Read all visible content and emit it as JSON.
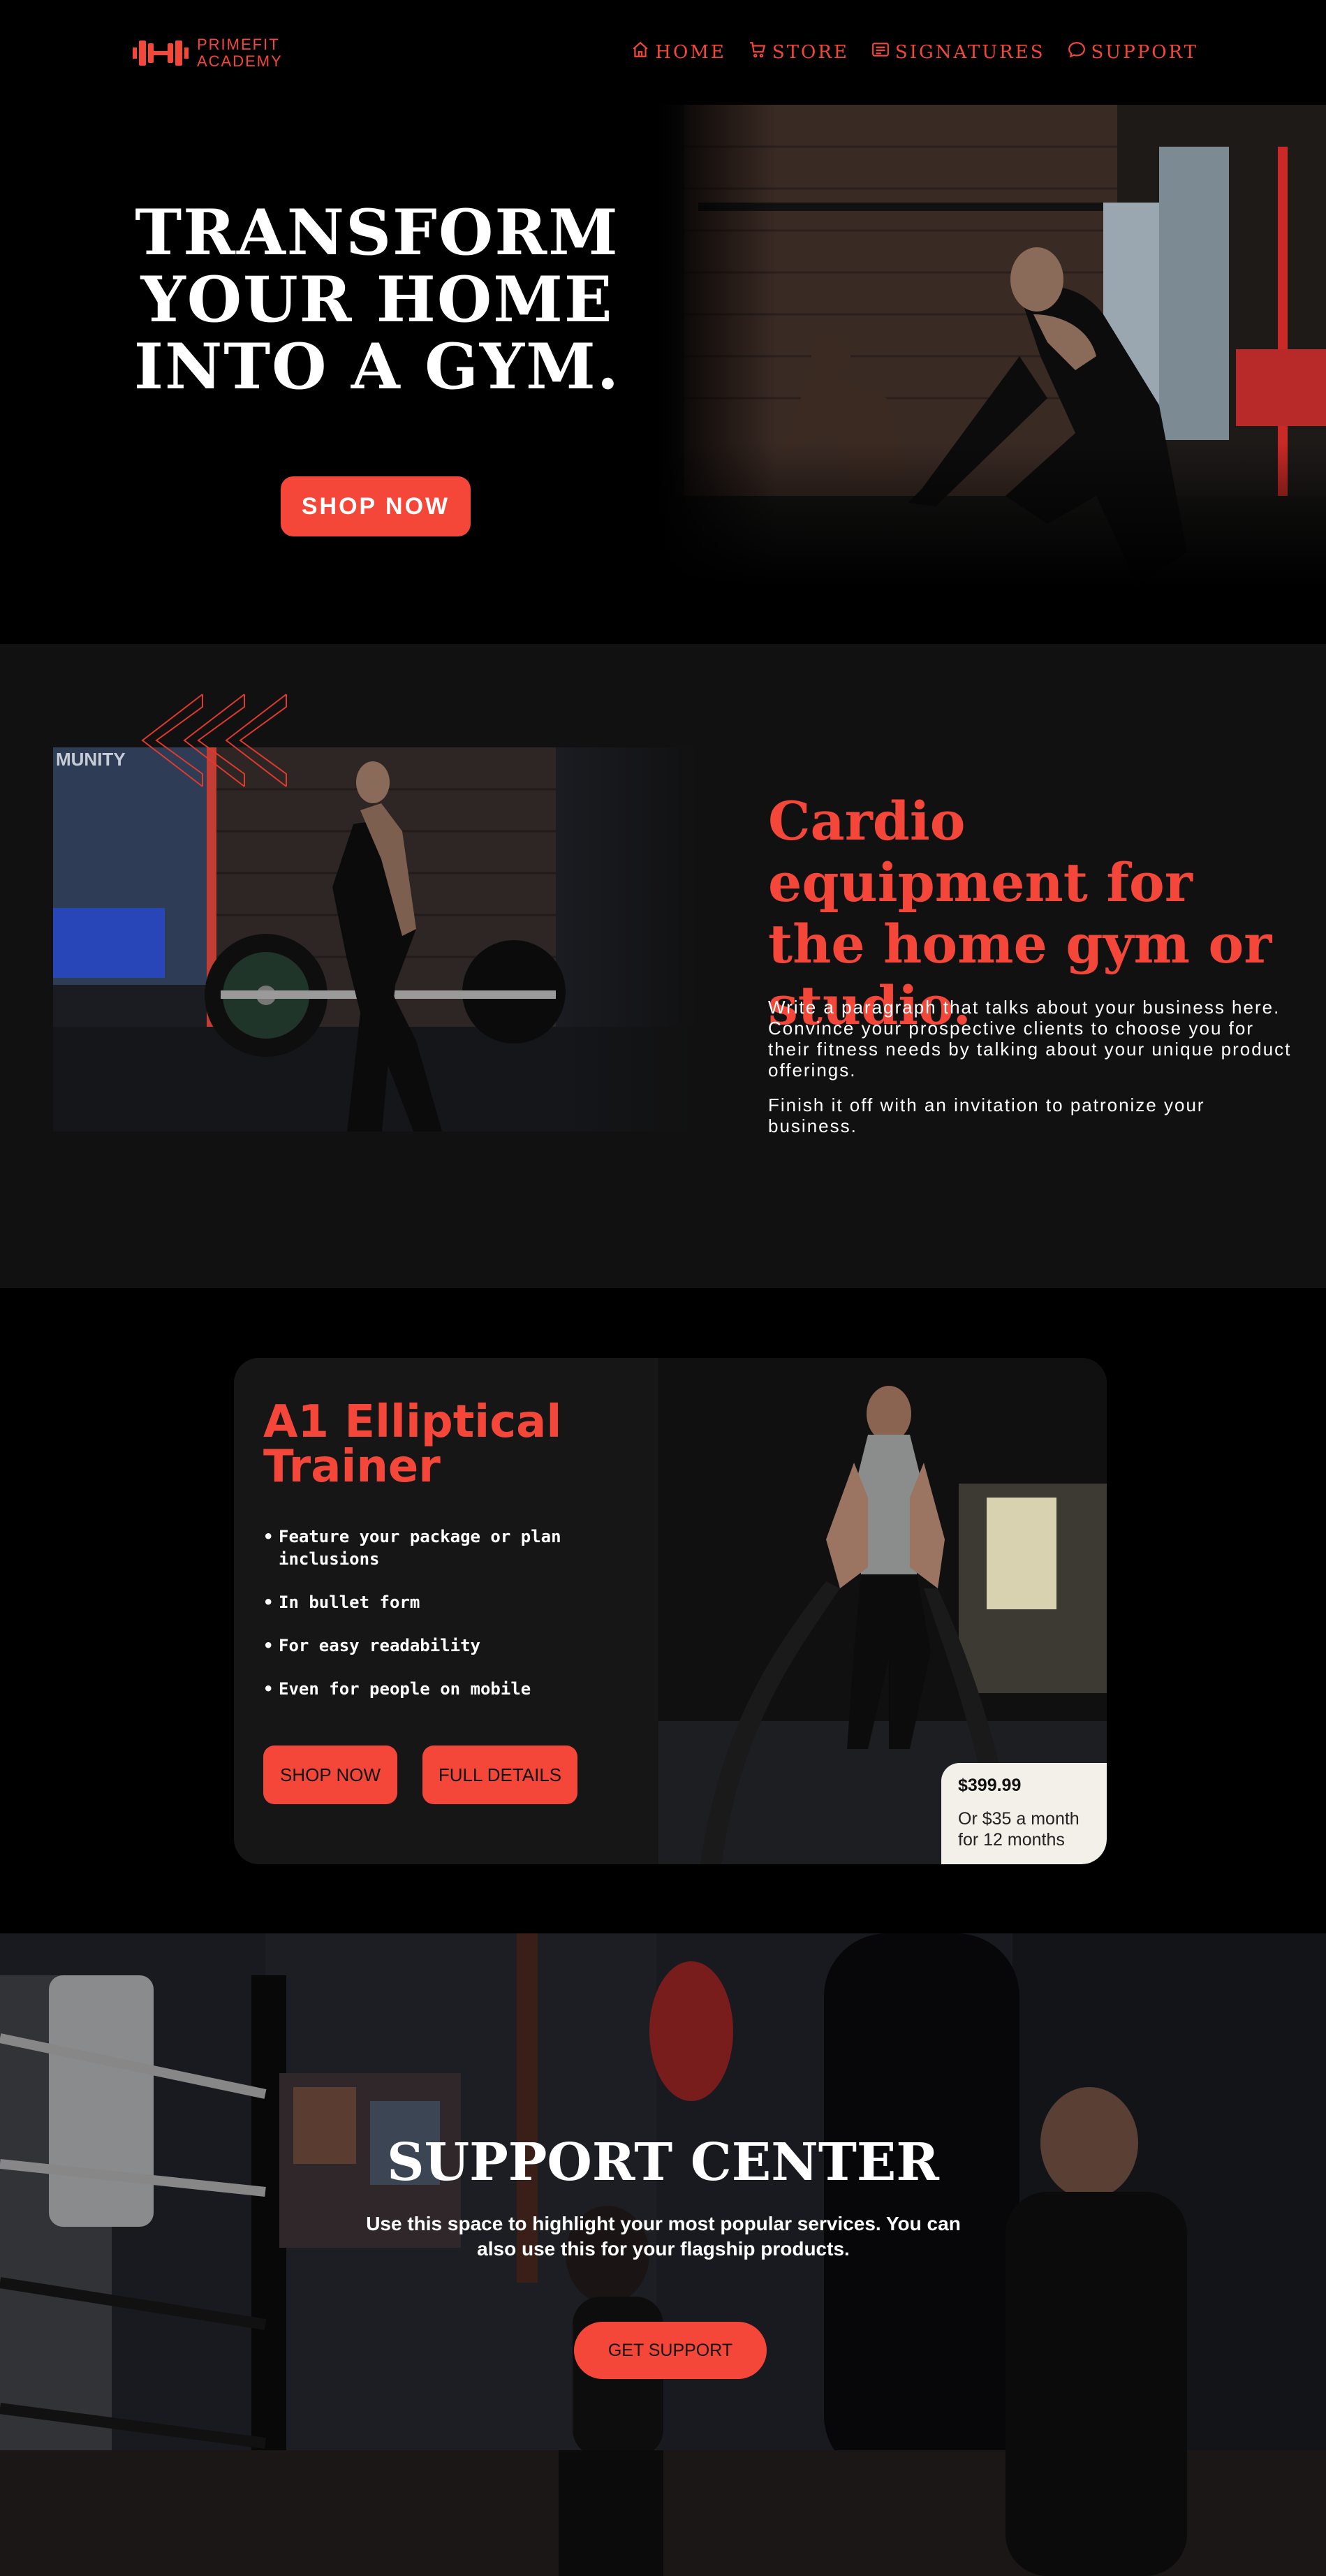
{
  "brand": {
    "name_line1": "PRIMEFIT",
    "name_line2": "ACADEMY",
    "accent": "#f4473a",
    "logo_icon": "dumbbell-icon"
  },
  "nav": {
    "items": [
      {
        "label": "HOME",
        "icon": "home-icon"
      },
      {
        "label": "STORE",
        "icon": "cart-icon"
      },
      {
        "label": "SIGNATURES",
        "icon": "list-icon"
      },
      {
        "label": "SUPPORT",
        "icon": "chat-icon"
      }
    ]
  },
  "hero": {
    "title_line1": "TRANSFORM",
    "title_line2": "YOUR HOME",
    "title_line3": "INTO A GYM.",
    "button": "SHOP NOW"
  },
  "cardio": {
    "title": "Cardio equipment for the home gym or studio.",
    "paragraph1": "Write a paragraph that talks about your business here. Convince your prospective clients to choose you for their fitness needs by talking about your unique product offerings.",
    "paragraph2": "Finish it off with an invitation to patronize your business."
  },
  "product": {
    "title": "A1 Elliptical Trainer",
    "features": [
      "Feature your package or plan inclusions",
      "In bullet form",
      "For easy readability",
      "Even for people on mobile"
    ],
    "shop_button": "SHOP NOW",
    "details_button": "FULL DETAILS",
    "price": "$399.99",
    "price_note": "Or $35 a month for 12 months"
  },
  "support": {
    "title": "SUPPORT CENTER",
    "text": "Use this space to highlight your most popular services. You can also use this for your flagship products.",
    "button": "GET SUPPORT"
  }
}
